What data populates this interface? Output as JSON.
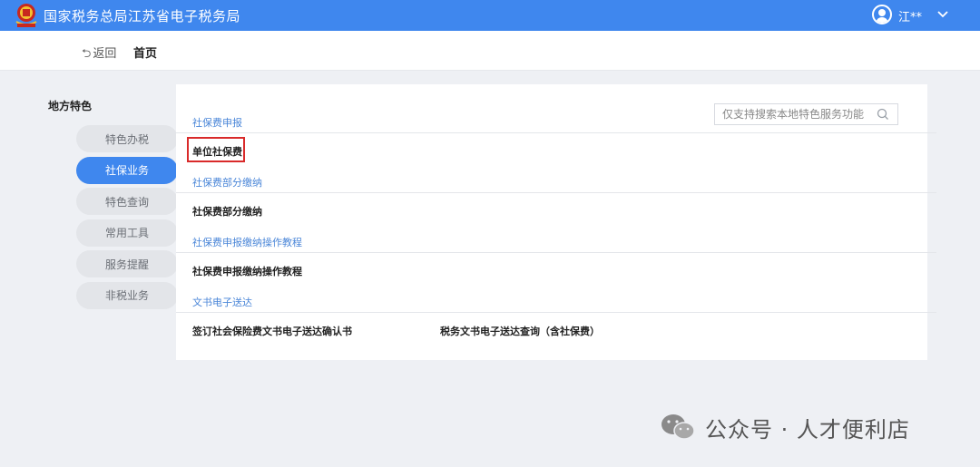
{
  "header": {
    "title": "国家税务总局江苏省电子税务局",
    "user_name": "江**",
    "accent_color": "#3f87ee"
  },
  "subheader": {
    "back_label": "返回",
    "page_title": "首页"
  },
  "sidebar": {
    "title": "地方特色",
    "items": [
      {
        "label": "特色办税",
        "active": false
      },
      {
        "label": "社保业务",
        "active": true
      },
      {
        "label": "特色查询",
        "active": false
      },
      {
        "label": "常用工具",
        "active": false
      },
      {
        "label": "服务提醒",
        "active": false
      },
      {
        "label": "非税业务",
        "active": false
      }
    ]
  },
  "search": {
    "placeholder": "仅支持搜索本地特色服务功能",
    "icon": "search-icon"
  },
  "sections": [
    {
      "title": "社保费申报",
      "items": [
        "单位社保费"
      ]
    },
    {
      "title": "社保费部分缴纳",
      "items": [
        "社保费部分缴纳"
      ]
    },
    {
      "title": "社保费申报缴纳操作教程",
      "items": [
        "社保费申报缴纳操作教程"
      ]
    },
    {
      "title": "文书电子送达",
      "items": [
        "签订社会保险费文书电子送达确认书",
        "税务文书电子送达查询（含社保费）"
      ]
    }
  ],
  "watermark": {
    "text": "公众号 · 人才便利店",
    "icon": "wechat-icon"
  },
  "colors": {
    "highlight": "#d92a2a",
    "category_blue": "#4a86d8"
  }
}
